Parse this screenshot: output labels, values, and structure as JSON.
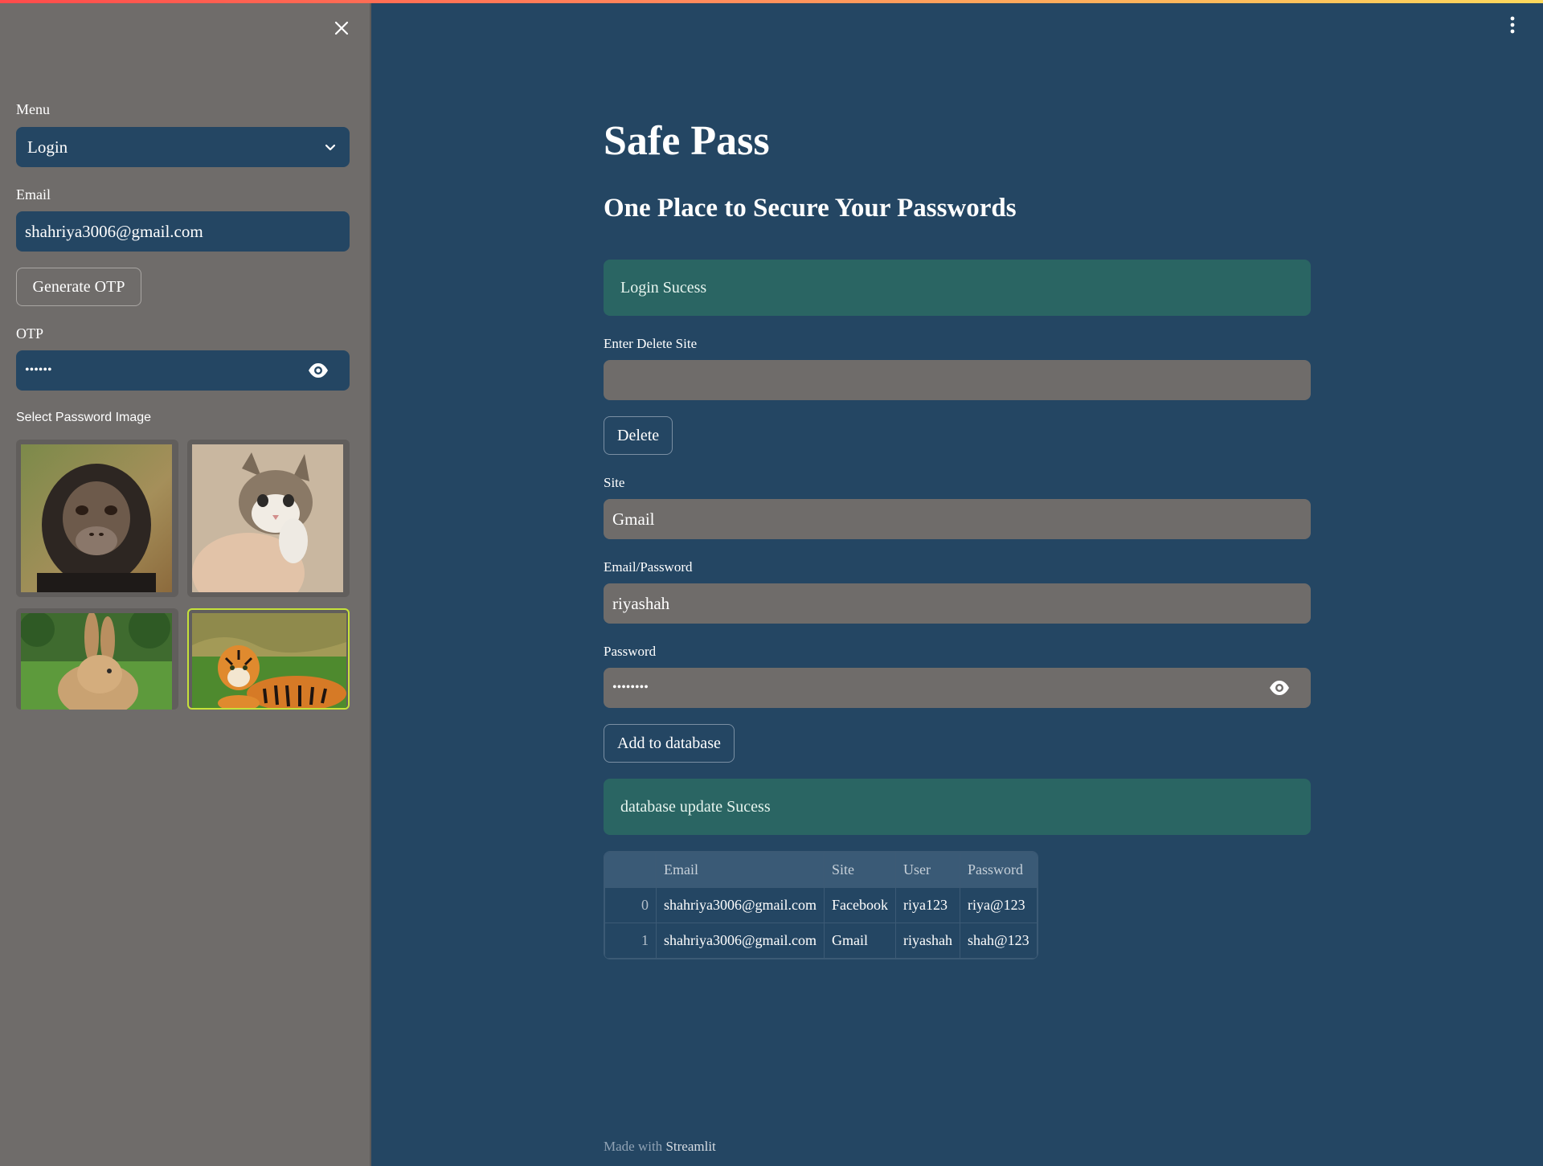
{
  "sidebar": {
    "menu_label": "Menu",
    "menu_selected": "Login",
    "email_label": "Email",
    "email_value": "shahriya3006@gmail.com",
    "generate_otp_label": "Generate OTP",
    "otp_label": "OTP",
    "otp_value": "••••••",
    "image_select_label": "Select Password Image",
    "images": [
      {
        "name": "chimpanzee",
        "selected": false
      },
      {
        "name": "kitten",
        "selected": false
      },
      {
        "name": "rabbit",
        "selected": false
      },
      {
        "name": "tiger",
        "selected": true
      }
    ]
  },
  "main": {
    "title": "Safe Pass",
    "subtitle": "One Place to Secure Your Passwords",
    "login_alert": "Login Sucess",
    "delete_site_label": "Enter Delete Site",
    "delete_site_value": "",
    "delete_button": "Delete",
    "site_label": "Site",
    "site_value": "Gmail",
    "email_password_label": "Email/Password",
    "email_password_value": "riyashah",
    "password_label": "Password",
    "password_value": "••••••••",
    "add_button": "Add to database",
    "db_alert": "database update Sucess",
    "table": {
      "columns": [
        "",
        "Email",
        "Site",
        "User",
        "Password"
      ],
      "rows": [
        [
          "0",
          "shahriya3006@gmail.com",
          "Facebook",
          "riya123",
          "riya@123"
        ],
        [
          "1",
          "shahriya3006@gmail.com",
          "Gmail",
          "riyashah",
          "shah@123"
        ]
      ]
    },
    "footer_prefix": "Made with",
    "footer_brand": "Streamlit"
  },
  "colors": {
    "main_bg": "#244663",
    "sidebar_bg": "#6f6c6a",
    "alert_bg": "#2a6563",
    "selected_outline": "#c6e23a"
  }
}
